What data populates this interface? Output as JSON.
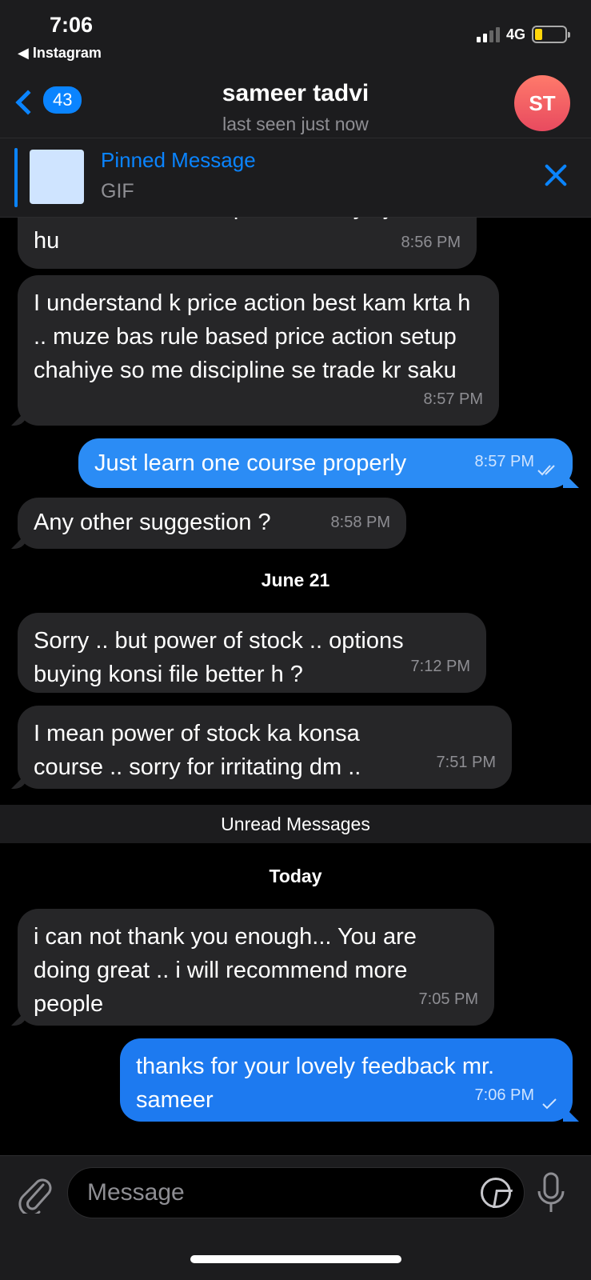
{
  "status": {
    "time": "7:06",
    "back_app": "◀ Instagram",
    "network": "4G"
  },
  "header": {
    "unread_count": "43",
    "title": "sameer tadvi",
    "subtitle": "last seen just now",
    "avatar_initials": "ST"
  },
  "pinned": {
    "title": "Pinned Message",
    "subtitle": "GIF"
  },
  "messages": [
    {
      "text": "frustrated .. course pr course kiye ja rha hu",
      "time": "8:56 PM",
      "dir": "in"
    },
    {
      "text": "I understand k price action best kam krta h .. muze bas rule based price action setup chahiye so me discipline se trade kr saku",
      "time": "8:57 PM",
      "dir": "in"
    },
    {
      "text": "Just learn one course properly",
      "time": "8:57 PM",
      "dir": "out",
      "status": "read"
    },
    {
      "text": "Any other suggestion ?",
      "time": "8:58 PM",
      "dir": "in"
    },
    {
      "text": "Sorry .. but power of stock .. options buying konsi file better h ?",
      "time": "7:12 PM",
      "dir": "in"
    },
    {
      "text": "I mean power of stock ka konsa course .. sorry for irritating dm ..",
      "time": "7:51 PM",
      "dir": "in"
    },
    {
      "text": "i can not thank you enough... You are doing great .. i will recommend more people",
      "time": "7:05 PM",
      "dir": "in"
    },
    {
      "text": "thanks for your lovely feedback mr. sameer",
      "time": "7:06 PM",
      "dir": "out",
      "status": "sent"
    }
  ],
  "separators": {
    "date1": "June 21",
    "unread": "Unread Messages",
    "date2": "Today"
  },
  "input": {
    "placeholder": "Message"
  },
  "colors": {
    "accent": "#0a84ff",
    "outgoing": "#2b8cf5",
    "incoming": "#262628"
  }
}
